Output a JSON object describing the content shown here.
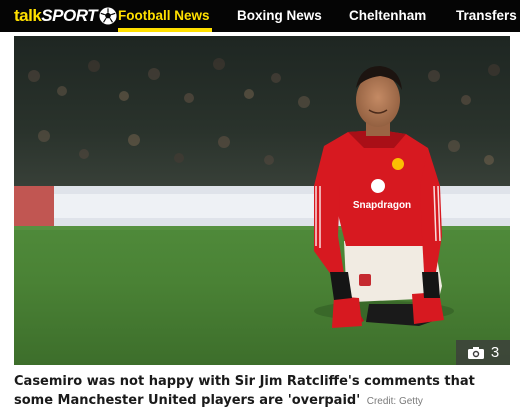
{
  "brand": {
    "talk": "talk",
    "sport": "SPORT",
    "ball_icon": "football-icon"
  },
  "nav": {
    "items": [
      {
        "label": "Football News",
        "active": true
      },
      {
        "label": "Boxing News",
        "active": false
      },
      {
        "label": "Cheltenham",
        "active": false
      },
      {
        "label": "Transfers",
        "active": false
      }
    ]
  },
  "hero": {
    "alt_subject": "Casemiro kneeling on the pitch in a red Manchester United shirt",
    "shirt_sponsor": "Snapdragon",
    "gallery_icon": "camera-icon",
    "gallery_count": "3"
  },
  "caption": {
    "text": "Casemiro was not happy with Sir Jim Ratcliffe's comments that some Manchester United players are 'overpaid'",
    "credit": "Credit: Getty"
  },
  "colors": {
    "nav_bg": "#050505",
    "accent": "#ffe000",
    "shirt_red": "#d71920"
  }
}
